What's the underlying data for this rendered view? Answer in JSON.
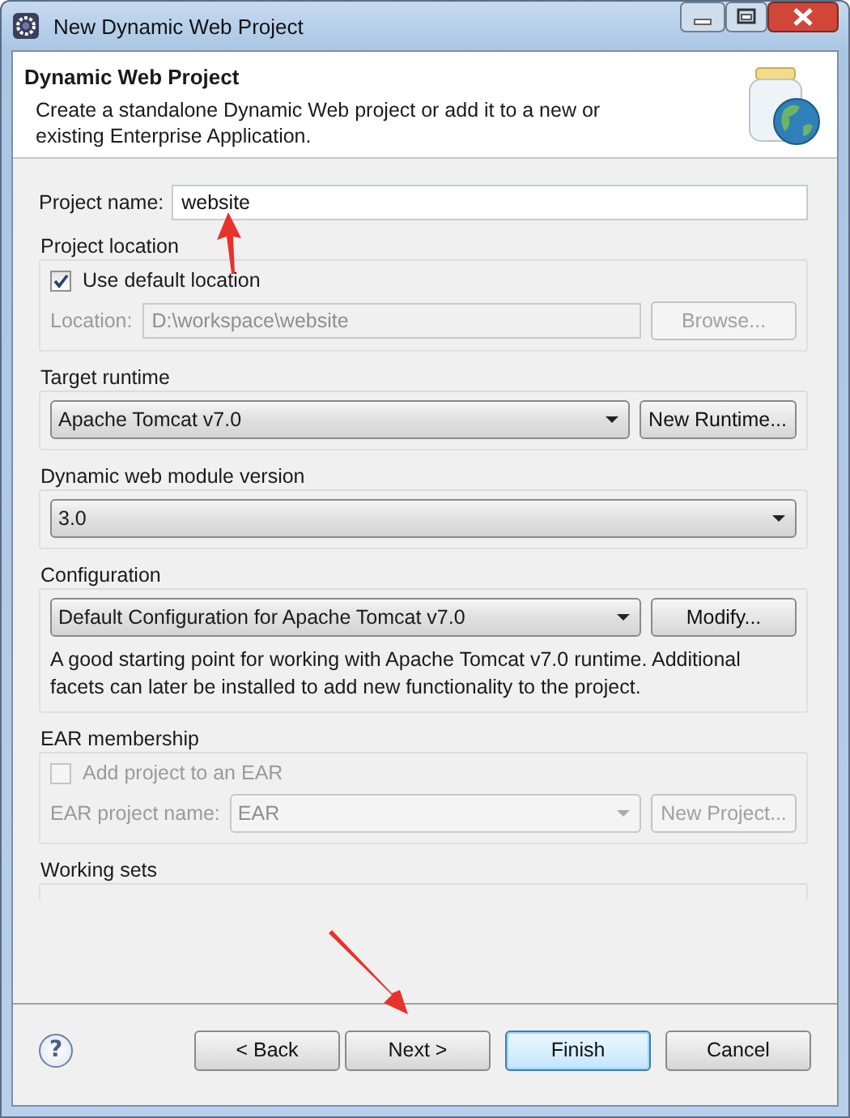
{
  "window": {
    "title": "New Dynamic Web Project"
  },
  "header": {
    "title": "Dynamic Web Project",
    "description": "Create a standalone Dynamic Web project or add it to a new or existing Enterprise Application."
  },
  "project_name": {
    "label": "Project name:",
    "value": "website"
  },
  "project_location": {
    "title": "Project location",
    "use_default": {
      "label": "Use default location",
      "checked": true
    },
    "location": {
      "label": "Location:",
      "value": "D:\\workspace\\website",
      "disabled": true
    },
    "browse": {
      "label": "Browse...",
      "disabled": true
    }
  },
  "target_runtime": {
    "title": "Target runtime",
    "value": "Apache Tomcat v7.0",
    "button": "New Runtime..."
  },
  "module_version": {
    "title": "Dynamic web module version",
    "value": "3.0"
  },
  "configuration": {
    "title": "Configuration",
    "value": "Default Configuration for Apache Tomcat v7.0",
    "button": "Modify...",
    "description": "A good starting point for working with Apache Tomcat v7.0 runtime. Additional facets can later be installed to add new functionality to the project."
  },
  "ear_membership": {
    "title": "EAR membership",
    "add_to_ear": {
      "label": "Add project to an EAR",
      "checked": false,
      "disabled": true
    },
    "ear_name": {
      "label": "EAR project name:",
      "value": "EAR",
      "disabled": true
    },
    "new_project": {
      "label": "New Project...",
      "disabled": true
    }
  },
  "working_sets": {
    "title": "Working sets"
  },
  "help": "?",
  "buttons": [
    {
      "label": "< Back",
      "default": false
    },
    {
      "label": "Next >",
      "default": false
    },
    {
      "label": "Finish",
      "default": true
    },
    {
      "label": "Cancel",
      "default": false
    }
  ]
}
